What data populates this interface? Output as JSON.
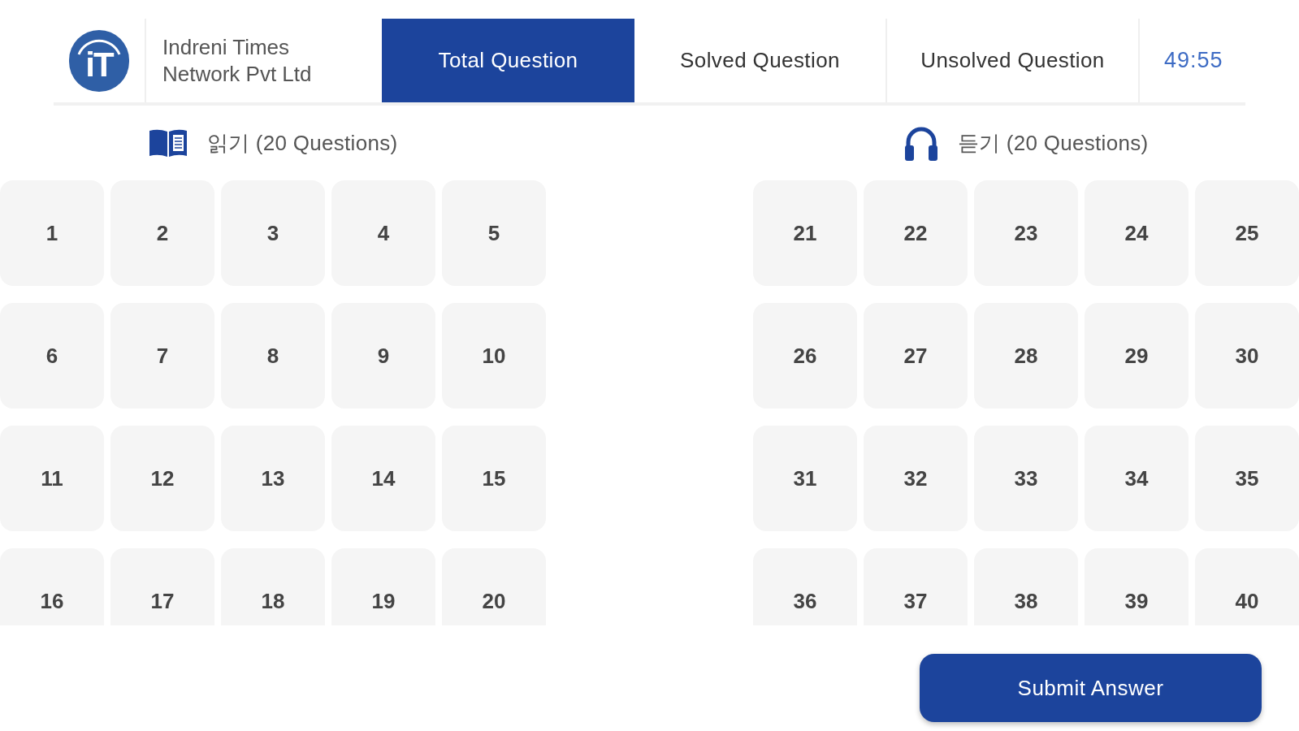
{
  "header": {
    "logo": "iT",
    "company": "Indreni Times Network Pvt Ltd",
    "tabs": [
      {
        "label": "Total Question",
        "selected": true
      },
      {
        "label": "Solved Question",
        "selected": false
      },
      {
        "label": "Unsolved Question",
        "selected": false
      }
    ],
    "timer": "49:55"
  },
  "sections": [
    {
      "kind": "reading",
      "title": "읽기 (20 Questions)",
      "questions": [
        "1",
        "2",
        "3",
        "4",
        "5",
        "6",
        "7",
        "8",
        "9",
        "10",
        "11",
        "12",
        "13",
        "14",
        "15",
        "16",
        "17",
        "18",
        "19",
        "20"
      ]
    },
    {
      "kind": "listening",
      "title": "듣기 (20 Questions)",
      "questions": [
        "21",
        "22",
        "23",
        "24",
        "25",
        "26",
        "27",
        "28",
        "29",
        "30",
        "31",
        "32",
        "33",
        "34",
        "35",
        "36",
        "37",
        "38",
        "39",
        "40"
      ]
    }
  ],
  "submit": "Submit Answer"
}
